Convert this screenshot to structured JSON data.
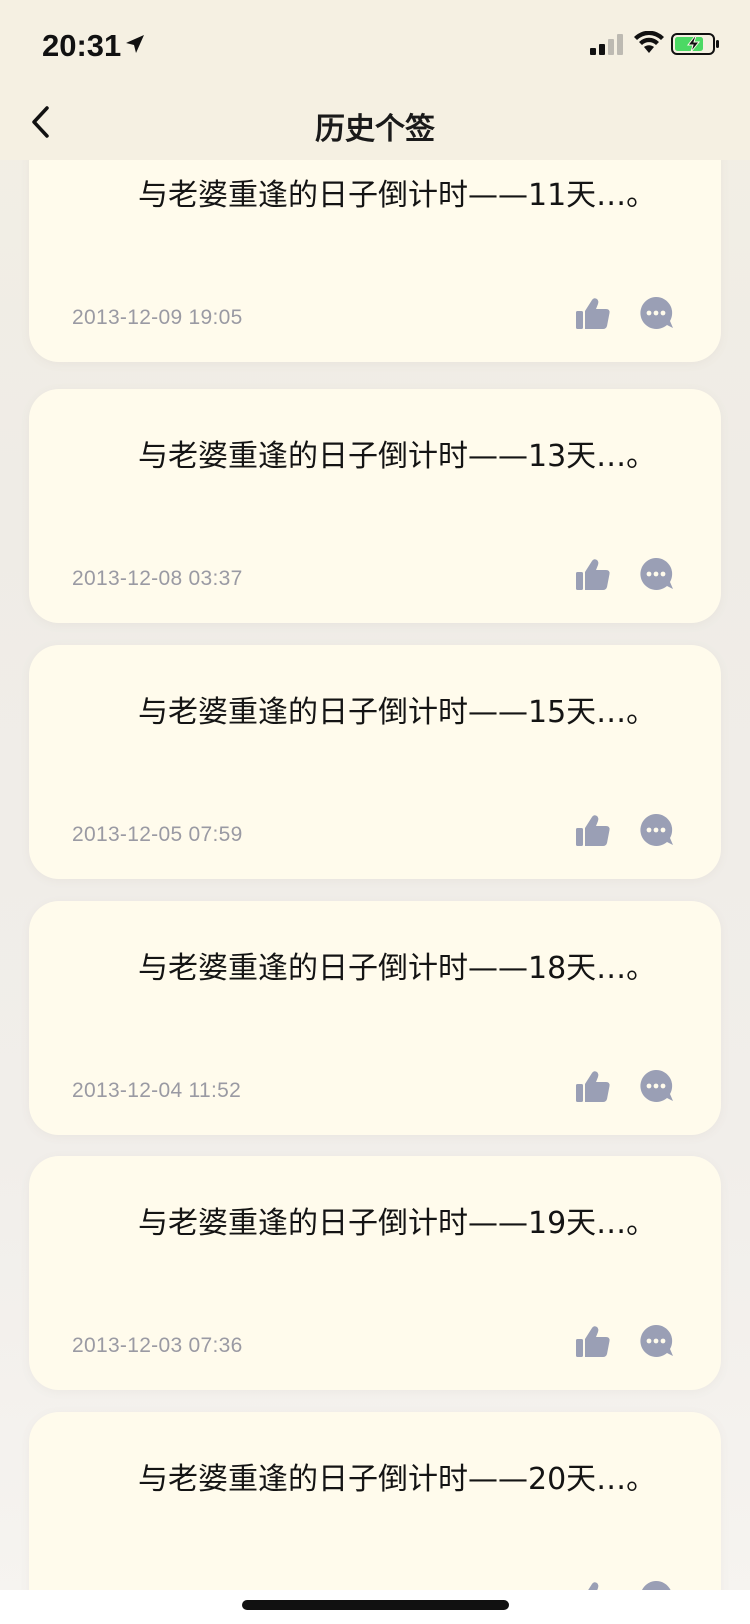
{
  "status_bar": {
    "time": "20:31"
  },
  "nav": {
    "title": "历史个签"
  },
  "posts": [
    {
      "text": "与老婆重逢的日子倒计时——11天…。",
      "date": "2013-12-09 19:05"
    },
    {
      "text": "与老婆重逢的日子倒计时——13天…。",
      "date": "2013-12-08 03:37"
    },
    {
      "text": "与老婆重逢的日子倒计时——15天…。",
      "date": "2013-12-05 07:59"
    },
    {
      "text": "与老婆重逢的日子倒计时——18天…。",
      "date": "2013-12-04 11:52"
    },
    {
      "text": "与老婆重逢的日子倒计时——19天…。",
      "date": "2013-12-03 07:36"
    },
    {
      "text": "与老婆重逢的日子倒计时——20天…。",
      "date": ""
    }
  ],
  "icons": {
    "like": "thumbs-up-icon",
    "comment": "comment-bubble-icon",
    "back": "chevron-left-icon"
  },
  "colors": {
    "background": "#f3efe4",
    "card": "#fffbec",
    "icon": "#9a9fb5",
    "date_text": "#9a9aa3",
    "battery_green": "#4cd964"
  }
}
